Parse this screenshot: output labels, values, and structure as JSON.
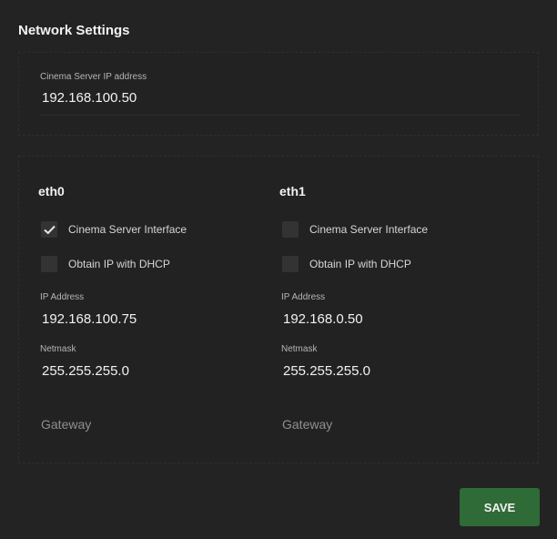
{
  "title": "Network Settings",
  "cinema_server": {
    "label": "Cinema Server IP address",
    "value": "192.168.100.50"
  },
  "interfaces": [
    {
      "name": "eth0",
      "cinema_interface": {
        "label": "Cinema Server Interface",
        "checked": true
      },
      "dhcp": {
        "label": "Obtain IP with DHCP",
        "checked": false
      },
      "ip": {
        "label": "IP Address",
        "value": "192.168.100.75"
      },
      "netmask": {
        "label": "Netmask",
        "value": "255.255.255.0"
      },
      "gateway": {
        "placeholder": "Gateway",
        "value": ""
      }
    },
    {
      "name": "eth1",
      "cinema_interface": {
        "label": "Cinema Server Interface",
        "checked": false
      },
      "dhcp": {
        "label": "Obtain IP with DHCP",
        "checked": false
      },
      "ip": {
        "label": "IP Address",
        "value": "192.168.0.50"
      },
      "netmask": {
        "label": "Netmask",
        "value": "255.255.255.0"
      },
      "gateway": {
        "placeholder": "Gateway",
        "value": ""
      }
    }
  ],
  "save_label": "SAVE",
  "icons": {
    "checked": "check-icon"
  },
  "colors": {
    "accent": "#2f6b36",
    "background": "#232323"
  }
}
